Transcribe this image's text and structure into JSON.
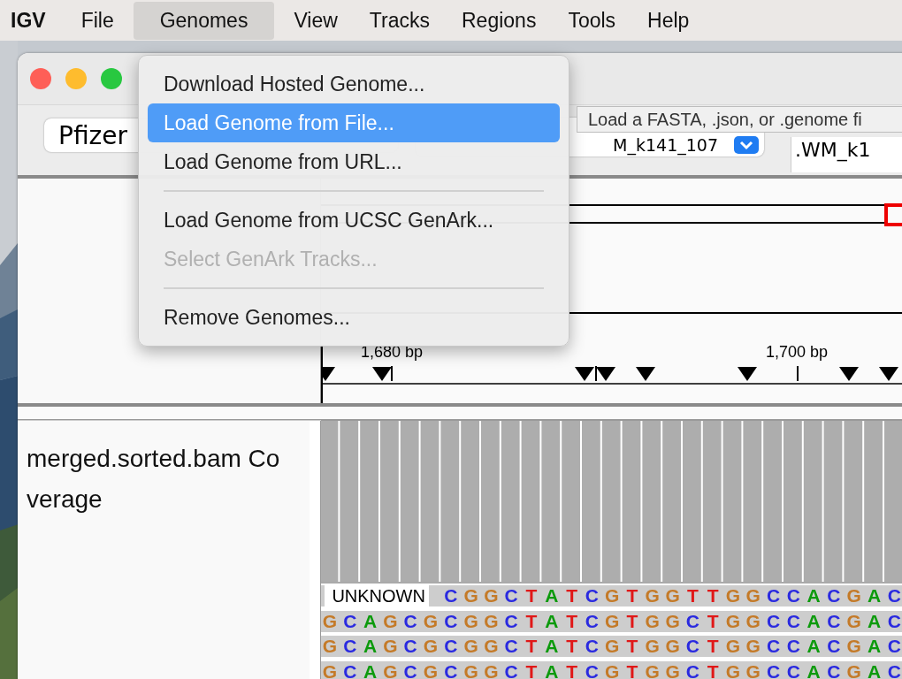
{
  "menubar": {
    "app": "IGV",
    "menus": [
      {
        "label": "File",
        "selected": false
      },
      {
        "label": "Genomes",
        "selected": true
      },
      {
        "label": "View",
        "selected": false
      },
      {
        "label": "Tracks",
        "selected": false
      },
      {
        "label": "Regions",
        "selected": false
      },
      {
        "label": "Tools",
        "selected": false
      },
      {
        "label": "Help",
        "selected": false
      }
    ]
  },
  "toolbar": {
    "genome": "Pfizer",
    "chromosome": "M_k141_107",
    "locus": ".WM_k1"
  },
  "genomes_menu": [
    {
      "kind": "item",
      "label": "Download Hosted Genome...",
      "selected": false,
      "disabled": false
    },
    {
      "kind": "item",
      "label": "Load Genome from File...",
      "selected": true,
      "disabled": false
    },
    {
      "kind": "item",
      "label": "Load Genome from URL...",
      "selected": false,
      "disabled": false
    },
    {
      "kind": "separator"
    },
    {
      "kind": "item",
      "label": "Load Genome from UCSC GenArk...",
      "selected": false,
      "disabled": false
    },
    {
      "kind": "item",
      "label": "Select GenArk Tracks...",
      "selected": false,
      "disabled": true
    },
    {
      "kind": "separator"
    },
    {
      "kind": "item",
      "label": "Remove Genomes...",
      "selected": false,
      "disabled": false
    }
  ],
  "tooltip": "Load a FASTA, .json, or .genome fi",
  "ruler": {
    "labels": [
      "1,680 bp",
      "1,700 bp"
    ]
  },
  "track": {
    "name": "merged.sorted.bam Coverage"
  },
  "reads": [
    {
      "label": "UNKNOWN",
      "bases": "C G G C T A T C G T G G T T G G C C A C G A C"
    },
    {
      "bases": "G C A G C G C G G C T A T C G T G G C T G G C C A C G A C"
    },
    {
      "bases": "G C A G C G C G G C T A T C G T G G C T G G C C A C G A C"
    },
    {
      "bases": "G C A G C G C G G C T A T C G T G G C T G G C C A C G A C"
    }
  ]
}
